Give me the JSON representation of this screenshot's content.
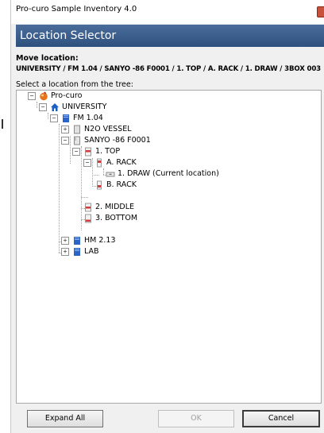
{
  "window": {
    "title": "Pro-curo Sample Inventory 4.0"
  },
  "dialog": {
    "header": "Location Selector",
    "move_label": "Move location:",
    "move_path": "UNIVERSITY / FM 1.04 / SANYO -86 F0001 / 1. TOP / A. RACK / 1. DRAW / 3BOX 003",
    "select_label": "Select a location from the tree:"
  },
  "tree": {
    "root": "Pro-curo",
    "university": "UNIVERSITY",
    "fm104": "FM 1.04",
    "n2o": "N2O VESSEL",
    "sanyo": "SANYO -86 F0001",
    "top": "1. TOP",
    "arack": "A. RACK",
    "draw": "1. DRAW (Current location)",
    "brack": "B. RACK",
    "middle": "2. MIDDLE",
    "bottom": "3. BOTTOM",
    "hm213": "HM 2.13",
    "lab": "LAB"
  },
  "buttons": {
    "expand_all": "Expand All",
    "ok": "OK",
    "cancel": "Cancel"
  },
  "colors": {
    "header_bg": "#3a5d8c",
    "accent_blue": "#1a5fc4",
    "rack_red": "#d23c3c"
  }
}
